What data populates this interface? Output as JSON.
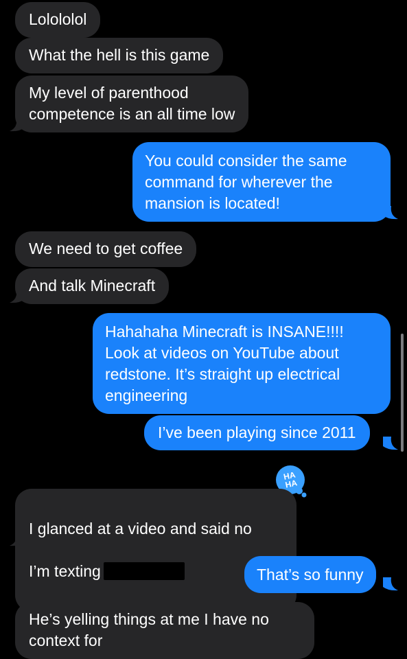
{
  "messages": [
    {
      "id": "m1",
      "dir": "in",
      "text": "Lolololol"
    },
    {
      "id": "m2",
      "dir": "in",
      "text": "What the hell is this game"
    },
    {
      "id": "m3",
      "dir": "in",
      "text": "My level of parenthood\ncompetence is an all time low"
    },
    {
      "id": "m4",
      "dir": "out",
      "text": "You could consider the same\ncommand for wherever the\nmansion is located!"
    },
    {
      "id": "m5",
      "dir": "in",
      "text": "We need to get coffee"
    },
    {
      "id": "m6",
      "dir": "in",
      "text": "And talk Minecraft"
    },
    {
      "id": "m7",
      "dir": "out",
      "text": "Hahahaha Minecraft is INSANE!!!!\nLook at videos on YouTube about\nredstone. It’s straight up electrical\nengineering"
    },
    {
      "id": "m8",
      "dir": "out",
      "text": "I’ve been playing since 2011"
    },
    {
      "id": "m9",
      "dir": "in",
      "line1": "I glanced at a video and said no",
      "line2": "I’m texting"
    },
    {
      "id": "m10",
      "dir": "out",
      "text": "That’s so funny"
    },
    {
      "id": "m11",
      "dir": "in",
      "text": "He’s yelling things at me I have no\ncontext for"
    }
  ],
  "tapback": {
    "label": "HA\nHA",
    "icon": "haha-reaction-icon",
    "color": "#3aa0ff"
  },
  "colors": {
    "incoming": "#262628",
    "outgoing": "#1a82fb",
    "background": "#000000"
  }
}
